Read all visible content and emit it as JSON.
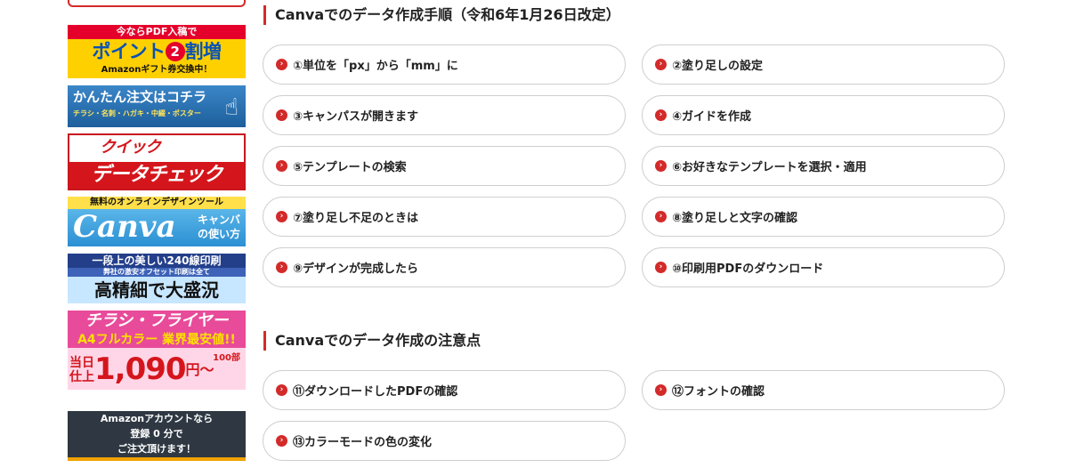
{
  "sidebar": {
    "banner1": {
      "strip": "今ならPDF入稿で",
      "main_a": "ポイント",
      "main_num": "2",
      "main_b": "割増",
      "sub": "Amazonギフト券交換中！"
    },
    "banner2": {
      "main": "かんたん注文はコチラ",
      "sub": "チラシ・名刺・ハガキ・中綴・ポスター",
      "icon": "pointer-hand-icon"
    },
    "banner3": {
      "line1": "クイック",
      "line2": "データチェック"
    },
    "banner4": {
      "top": "無料のオンラインデザインツール",
      "logo": "Canva",
      "side1": "キャンバ",
      "side2": "の使い方"
    },
    "banner5": {
      "line1": "一段上の美しい240線印刷",
      "line2": "弊社の激安オフセット印刷は全て",
      "line3": "高精細で大盛況"
    },
    "banner6": {
      "line1": "チラシ・フライヤー",
      "line2": "A4フルカラー 業界最安値!!",
      "small1": "当日",
      "small2": "仕上",
      "price": "1,090",
      "unit": "円〜",
      "count": "100部"
    },
    "banner7": {
      "line1": "Amazonアカウントなら",
      "line2": "登録 0 分で",
      "line3": "ご注文頂けます！"
    }
  },
  "sections": {
    "procedure": {
      "heading": "Canvaでのデータ作成手順（令和6年1月26日改定）",
      "items": [
        "①単位を「px」から「mm」に",
        "②塗り足しの設定",
        "③キャンパスが開きます",
        "④ガイドを作成",
        "⑤テンプレートの検索",
        "⑥お好きなテンプレートを選択・適用",
        "⑦塗り足し不足のときは",
        "⑧塗り足しと文字の確認",
        "⑨デザインが完成したら",
        "⑩印刷用PDFのダウンロード"
      ]
    },
    "notes": {
      "heading": "Canvaでのデータ作成の注意点",
      "items": [
        "⑪ダウンロードしたPDFの確認",
        "⑫フォントの確認",
        "⑬カラーモードの色の変化"
      ]
    }
  },
  "icons": {
    "bullet": "chevron-right-circle-icon",
    "bullet_glyph": "›"
  },
  "colors": {
    "accent": "#d32a2a",
    "button_border": "#cfcfcf"
  }
}
